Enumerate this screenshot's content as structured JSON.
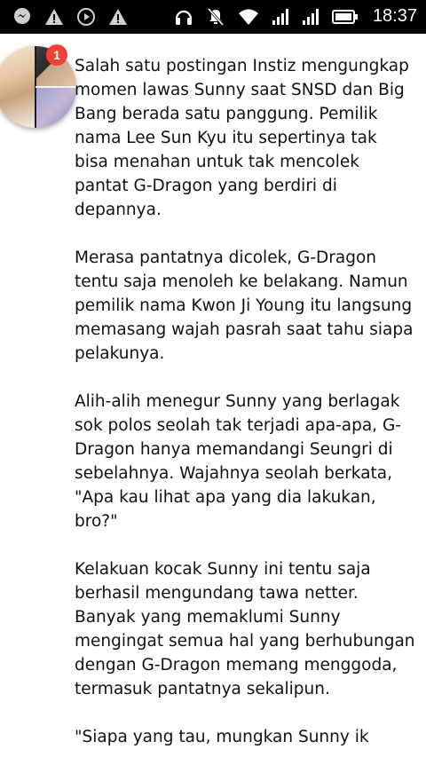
{
  "status_bar": {
    "left_icons": [
      "messenger-icon",
      "warning-icon",
      "play-icon",
      "warning-icon"
    ],
    "right_icons": [
      "headset-icon",
      "mute-icon",
      "wifi-icon",
      "signal-icon",
      "signal-icon",
      "battery-icon"
    ],
    "time": "18:37"
  },
  "notification": {
    "badge_count": "1"
  },
  "article": {
    "paragraphs": [
      "Salah satu postingan Instiz mengungkap momen lawas Sunny saat SNSD dan Big Bang berada satu panggung. Pemilik nama Lee Sun Kyu itu sepertinya tak bisa menahan untuk tak mencolek pantat G-Dragon yang berdiri di depannya.",
      "Merasa pantatnya dicolek, G-Dragon tentu saja menoleh ke belakang. Namun pemilik nama Kwon Ji Young itu langsung memasang wajah pasrah saat tahu siapa pelakunya.",
      "Alih-alih menegur Sunny yang berlagak sok polos seolah tak terjadi apa-apa, G-Dragon hanya memandangi Seungri di sebelahnya. Wajahnya seolah berkata, \"Apa kau lihat apa yang dia lakukan, bro?\"",
      "Kelakuan kocak Sunny ini tentu saja berhasil mengundang tawa netter. Banyak yang memaklumi Sunny mengingat semua hal yang berhubungan dengan G-Dragon memang menggoda, termasuk pantatnya sekalipun.",
      "\"Siapa yang tau, mungkan Sunny ik"
    ]
  }
}
